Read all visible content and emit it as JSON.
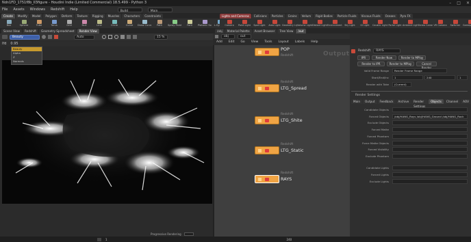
{
  "window": {
    "title": "Ndn1FD_1751f8b_II3figure - Houdini Indie (Limited Commercial) 18.5.499 - Python 3",
    "controls": [
      "–",
      "□",
      "✕"
    ]
  },
  "menubar": {
    "items": [
      "File",
      "Assets",
      "Windows",
      "Redshift",
      "Help"
    ],
    "build_field": "Build",
    "desk_field": "Main"
  },
  "shelf_tabs": [
    "Create",
    "Modify",
    "Model",
    "Polygon",
    "Deform",
    "Texture",
    "Rigging",
    "Muscles",
    "Characters",
    "Constraints",
    "Hair Utils",
    "Guide Process",
    "Terrain FX",
    "Simple FX",
    "Volume",
    "Prof.(1)"
  ],
  "shelf_tools": [
    "Box",
    "Sphere",
    "Tube",
    "Torus",
    "Grid",
    "Null",
    "Line",
    "Circle",
    "Curve",
    "Draw Curve",
    "Path",
    "Spray Paint",
    "Font",
    "Platonic Solids",
    "L-System",
    "Metaball",
    "File"
  ],
  "shelf_tabs2": [
    "Lights and Cameras",
    "Collisions",
    "Particles",
    "Grains",
    "Vellum",
    "Rigid Bodies",
    "Particle Fluids",
    "Viscous Fluids",
    "Oceans",
    "Pyro FX",
    "FEM",
    "Wires",
    "Crowds",
    "Drive Simulation"
  ],
  "shelf_tools2": [
    "Camera",
    "Point Light",
    "Spot Light",
    "Area Light",
    "Geometry Light",
    "Volume Light",
    "Distant Light",
    "Environment Light",
    "Sky Light",
    "GI Light",
    "Caustic Light",
    "Portal Light",
    "Ambient Light",
    "Stereo Camera",
    "VR Camera",
    "Switcher",
    "Gamepad Camera"
  ],
  "viewer": {
    "tabs": [
      "Scene View",
      "Redshift",
      "Geometry Spreadsheet",
      "Render View"
    ],
    "render_dropdown_value": "Beauty",
    "dropdown_options": [
      "Beauty",
      "Alpha",
      "Z",
      "Normals"
    ],
    "auto_label": "Auto",
    "zoom_value": "15 %",
    "progressive_label": "Progressive Rendering",
    "side_labels": [
      "Ifd",
      "0.95"
    ]
  },
  "network": {
    "tabs": [
      "/obj",
      "Material Palette",
      "Asset Browser",
      "Tree View",
      "/out"
    ],
    "path": [
      "obj",
      "out"
    ],
    "menu": [
      "Add",
      "Edit",
      "Go",
      "View",
      "Tools",
      "Layout",
      "Labels",
      "Help"
    ],
    "outputs_label": "Outputs",
    "nodes": [
      {
        "type": "",
        "name": "POP",
        "sub": "Redshift"
      },
      {
        "type": "Redshift",
        "name": "LTG_Spread"
      },
      {
        "type": "Redshift",
        "name": "LTG_Shite"
      },
      {
        "type": "Redshift",
        "name": "LTG_Static"
      },
      {
        "type": "Redshift",
        "name": "RAYS"
      }
    ]
  },
  "params": {
    "node_type": "Redshift",
    "node_name": "RAYS",
    "buttons": [
      "IPR",
      "Render Now",
      "Render to MPlay",
      "Render to IPR",
      "Render to MPlay",
      "Cancel Render"
    ],
    "valid_frame_range_label": "Valid Frame Range",
    "valid_frame_range": "Render Frame Range",
    "start_end_inc_label": "Start/End/Inc",
    "start_end_inc": [
      "1",
      "240",
      "1"
    ],
    "render_with_take_label": "Render with Take",
    "render_with_take": "(Current)",
    "section": "Render Settings",
    "tabs": [
      "Main",
      "Output",
      "Feedback",
      "Archive",
      "Render Settings",
      "Objects",
      "Channel",
      "AOV"
    ],
    "rows": [
      {
        "label": "Candidate Objects",
        "value": ""
      },
      {
        "label": "Forced Objects",
        "value": "/obj/HANG_Rays /obj/HANG_Ground /obj/HANG_Rock"
      },
      {
        "label": "Exclude Objects",
        "value": ""
      },
      {
        "label": "Forced Matte",
        "value": ""
      },
      {
        "label": "Forced Phantom",
        "value": ""
      },
      {
        "label": "Force Matte Objects",
        "value": ""
      },
      {
        "label": "Forced Visibility",
        "value": ""
      },
      {
        "label": "Exclude Phantom",
        "value": ""
      },
      {
        "label": "Candidate Lights",
        "value": ""
      },
      {
        "label": "Forced Lights",
        "value": ""
      },
      {
        "label": "Exclude Lights",
        "value": ""
      }
    ]
  },
  "timeline": {
    "frame": "1",
    "end": "240"
  }
}
